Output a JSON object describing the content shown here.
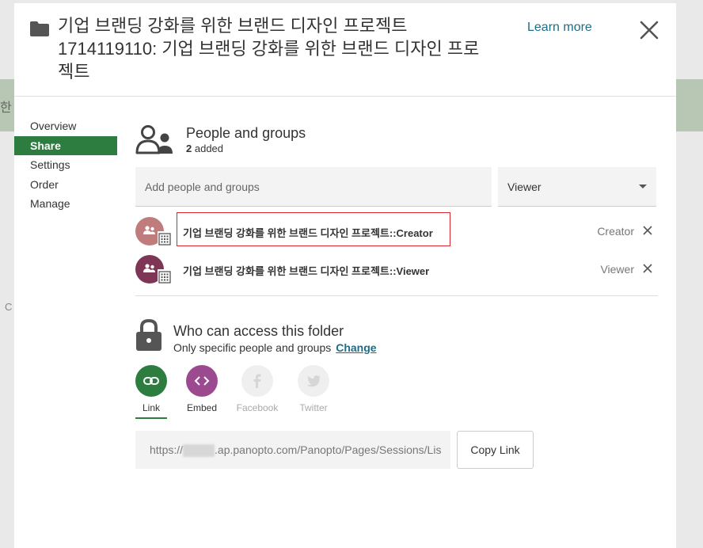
{
  "dialog": {
    "title": "기업 브랜딩 강화를 위한 브랜드 디자인 프로젝트 1714119110: 기업 브랜딩 강화를 위한 브랜드 디자인 프로젝트",
    "learn_more": "Learn more"
  },
  "nav": {
    "items": [
      {
        "label": "Overview"
      },
      {
        "label": "Share",
        "active": true
      },
      {
        "label": "Settings"
      },
      {
        "label": "Order"
      },
      {
        "label": "Manage"
      }
    ]
  },
  "people": {
    "title": "People and groups",
    "count": "2",
    "count_suffix": "added",
    "add_placeholder": "Add people and groups",
    "role_selected": "Viewer",
    "members": [
      {
        "name": "기업 브랜딩 강화를 위한 브랜드 디자인 프로젝트::Creator",
        "role": "Creator",
        "avatar_color": "#c07c7c"
      },
      {
        "name": "기업 브랜딩 강화를 위한 브랜드 디자인 프로젝트::Viewer",
        "role": "Viewer",
        "avatar_color": "#7e3556"
      }
    ]
  },
  "access": {
    "title": "Who can access this folder",
    "subtitle": "Only specific people and groups",
    "change": "Change"
  },
  "share_options": [
    {
      "label": "Link",
      "icon": "link-icon",
      "color": "#2e7d40",
      "active": true
    },
    {
      "label": "Embed",
      "icon": "embed-icon",
      "color": "#9b4a8f"
    },
    {
      "label": "Facebook",
      "icon": "facebook-icon",
      "color": "#efefef"
    },
    {
      "label": "Twitter",
      "icon": "twitter-icon",
      "color": "#efefef"
    }
  ],
  "link": {
    "url_prefix": "https://",
    "url_rest": ".ap.panopto.com/Panopto/Pages/Sessions/Lis",
    "copy_label": "Copy Link"
  },
  "background": {
    "fragment1": "한 :",
    "fragment2": "C"
  },
  "colors": {
    "accent_green": "#2e7d40",
    "link_blue": "#1d6d87",
    "highlight_red": "#d9262c"
  }
}
